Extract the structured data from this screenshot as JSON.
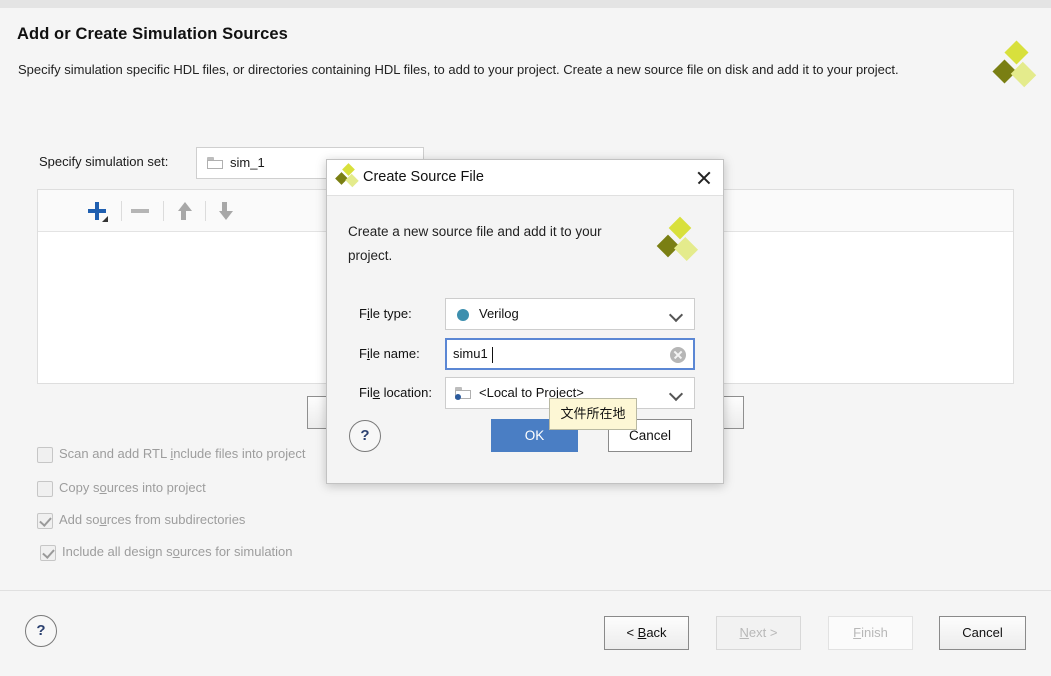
{
  "wizard": {
    "title": "Add or Create Simulation Sources",
    "description": "Specify simulation specific HDL files, or directories containing HDL files, to add to your project. Create a new source file on disk and add it to your project.",
    "logo_colors": {
      "bright": "#d8e03c",
      "dark": "#7a7f13",
      "pale": "#e4eb8c"
    },
    "simulation_set": {
      "label": "Specify simulation set:",
      "value": "sim_1",
      "icon": "folder-icon"
    },
    "toolbar": {
      "add": "add-icon",
      "remove": "remove-icon",
      "move_up": "arrow-up-icon",
      "move_down": "arrow-down-icon"
    },
    "options": [
      {
        "label_before": "Scan and add RTL ",
        "accel": "i",
        "label_after": "nclude files into project",
        "checked": false
      },
      {
        "label_before": "Copy s",
        "accel": "o",
        "label_after": "urces into project",
        "checked": false
      },
      {
        "label_before": "Add so",
        "accel": "u",
        "label_after": "rces from subdirectories",
        "checked": true
      },
      {
        "label_before": "Include all design s",
        "accel": "o",
        "label_after": "urces for simulation",
        "checked": true
      }
    ],
    "footer": {
      "help": "?",
      "buttons": [
        {
          "before": "< ",
          "accel": "B",
          "after": "ack",
          "state": "enabled"
        },
        {
          "before": "",
          "accel": "N",
          "after": "ext >",
          "state": "disabled"
        },
        {
          "before": "",
          "accel": "F",
          "after": "inish",
          "state": "disabled"
        },
        {
          "before": "",
          "accel": "",
          "after": "Cancel",
          "state": "enabled"
        }
      ]
    }
  },
  "dialog": {
    "title": "Create Source File",
    "close_icon": "close-icon",
    "intro": "Create a new source file and add it to your project.",
    "fields": {
      "file_type": {
        "label_before": "F",
        "accel": "i",
        "label_after": "le type:",
        "value": "Verilog",
        "dot_color": "#3d8fae"
      },
      "file_name": {
        "label_before": "F",
        "accel": "i",
        "label_after": "le name:",
        "value": "simu1"
      },
      "file_location": {
        "label_before": "Fil",
        "accel": "e",
        "label_after": " location:",
        "value": "<Local to Project>",
        "icon": "folder-local-icon"
      }
    },
    "help": "?",
    "ok": "OK",
    "cancel": "Cancel",
    "ok_color": "#4a7ec4"
  },
  "tooltip": {
    "text": "文件所在地"
  }
}
